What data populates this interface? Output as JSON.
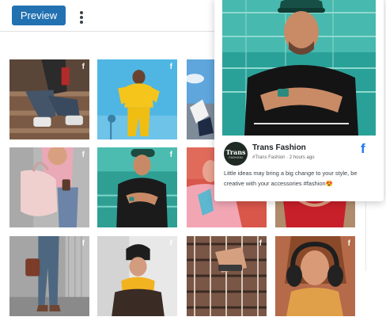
{
  "toolbar": {
    "preview_label": "Preview",
    "more_icon": "kebab-vertical-icon",
    "accent": "#2271b1"
  },
  "feed": {
    "network_icon": "facebook-icon",
    "network_glyph": "f",
    "posts": [
      {
        "subject": "man sitting on steps in jeans and sneakers"
      },
      {
        "subject": "woman in yellow tracksuit"
      },
      {
        "subject": "sneakers and sky"
      },
      {
        "subject": "woman with pink backpack"
      },
      {
        "subject": "man in black t-shirt with watch"
      },
      {
        "subject": "woman in pink sweater"
      },
      {
        "subject": "red top"
      },
      {
        "subject": "legs in jeans with brown bag"
      },
      {
        "subject": "woman in black beanie and yellow scarf"
      },
      {
        "subject": "hand in checked flannel shirt"
      },
      {
        "subject": "woman with headphones"
      }
    ]
  },
  "popup": {
    "avatar_text": "Trans",
    "avatar_subtext": "FASHION",
    "account_name": "Trans Fashion",
    "account_handle": "#Trans Fashion · 2 hours ago",
    "network_glyph": "f",
    "network_color": "#1877f2",
    "caption": "Little ideas may bring a big change to your style, be creative with your accessories #fashion😍"
  }
}
